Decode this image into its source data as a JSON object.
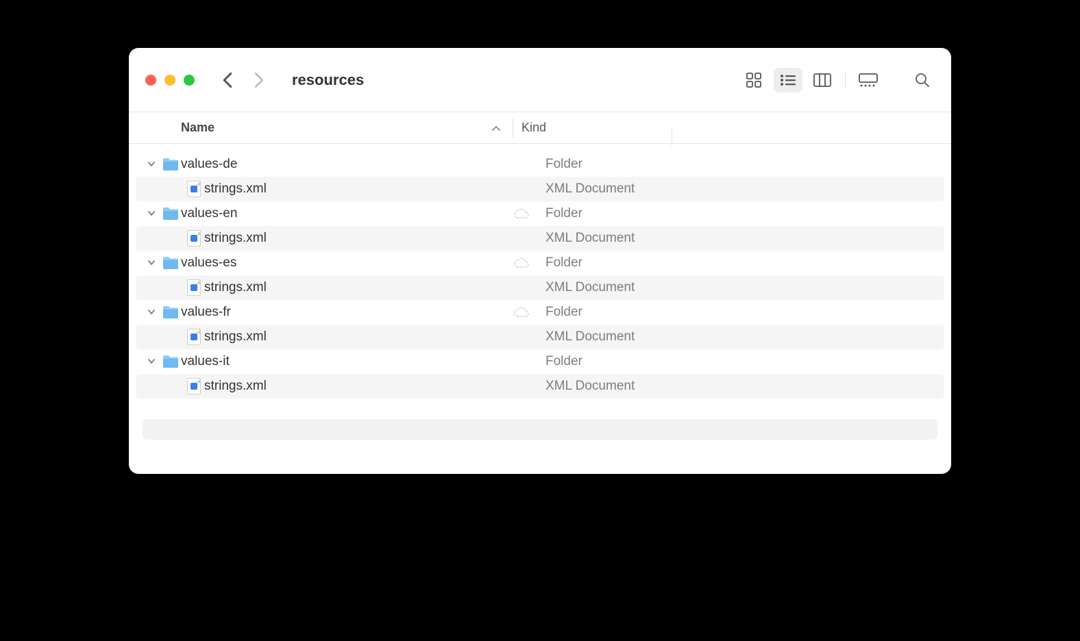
{
  "window": {
    "title": "resources"
  },
  "columns": {
    "name": "Name",
    "kind": "Kind"
  },
  "kinds": {
    "folder": "Folder",
    "xml": "XML Document"
  },
  "items": [
    {
      "name": "values-de",
      "type": "folder",
      "cloud": false,
      "children": [
        {
          "name": "strings.xml",
          "type": "xml"
        }
      ]
    },
    {
      "name": "values-en",
      "type": "folder",
      "cloud": true,
      "children": [
        {
          "name": "strings.xml",
          "type": "xml"
        }
      ]
    },
    {
      "name": "values-es",
      "type": "folder",
      "cloud": true,
      "children": [
        {
          "name": "strings.xml",
          "type": "xml"
        }
      ]
    },
    {
      "name": "values-fr",
      "type": "folder",
      "cloud": true,
      "children": [
        {
          "name": "strings.xml",
          "type": "xml"
        }
      ]
    },
    {
      "name": "values-it",
      "type": "folder",
      "cloud": false,
      "children": [
        {
          "name": "strings.xml",
          "type": "xml"
        }
      ]
    }
  ]
}
